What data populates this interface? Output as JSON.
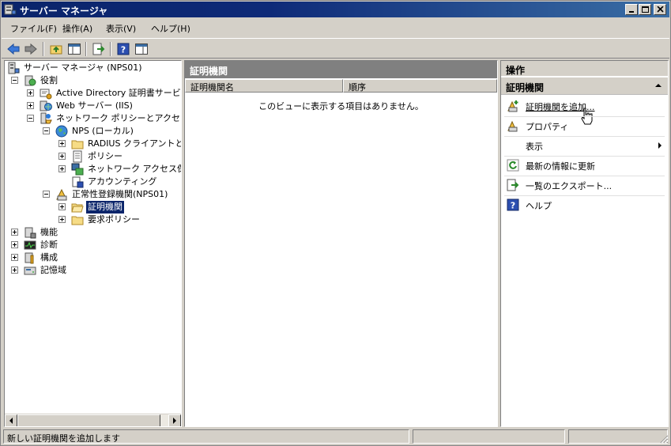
{
  "window": {
    "title": "サーバー マネージャ"
  },
  "menu": [
    {
      "label": "ファイル(F)"
    },
    {
      "label": "操作(A)"
    },
    {
      "label": "表示(V)"
    },
    {
      "label": "ヘルプ(H)"
    }
  ],
  "tree": {
    "root": "サーバー マネージャ (NPS01)",
    "roles": "役割",
    "active_directory": "Active Directory 証明書サービス",
    "web_server": "Web サーバー (IIS)",
    "npas": "ネットワーク ポリシーとアクセス サービス",
    "nps_local": "NPS (ローカル)",
    "radius": "RADIUS クライアントとサーバー",
    "policies": "ポリシー",
    "nap": "ネットワーク アクセス保護",
    "accounting": "アカウンティング",
    "hra": "正常性登録機関(NPS01)",
    "ca": "証明機関",
    "request_policy": "要求ポリシー",
    "features": "機能",
    "diagnostics": "診断",
    "configuration": "構成",
    "storage": "記憶域"
  },
  "center": {
    "header": "証明機関",
    "columns": [
      "証明機関名",
      "順序"
    ],
    "empty_message": "このビューに表示する項目はありません。"
  },
  "actions": {
    "header": "操作",
    "section": "証明機関",
    "items": [
      {
        "label": "証明機関を追加..."
      },
      {
        "label": "プロパティ"
      },
      {
        "label": "表示"
      },
      {
        "label": "最新の情報に更新"
      },
      {
        "label": "一覧のエクスポート..."
      },
      {
        "label": "ヘルプ"
      }
    ]
  },
  "status": {
    "text": "新しい証明機関を追加します"
  },
  "colors": {
    "title_bar": "#0a246a",
    "selection": "#0a246a",
    "pane_header": "#808080",
    "chrome": "#d4d0c8"
  }
}
